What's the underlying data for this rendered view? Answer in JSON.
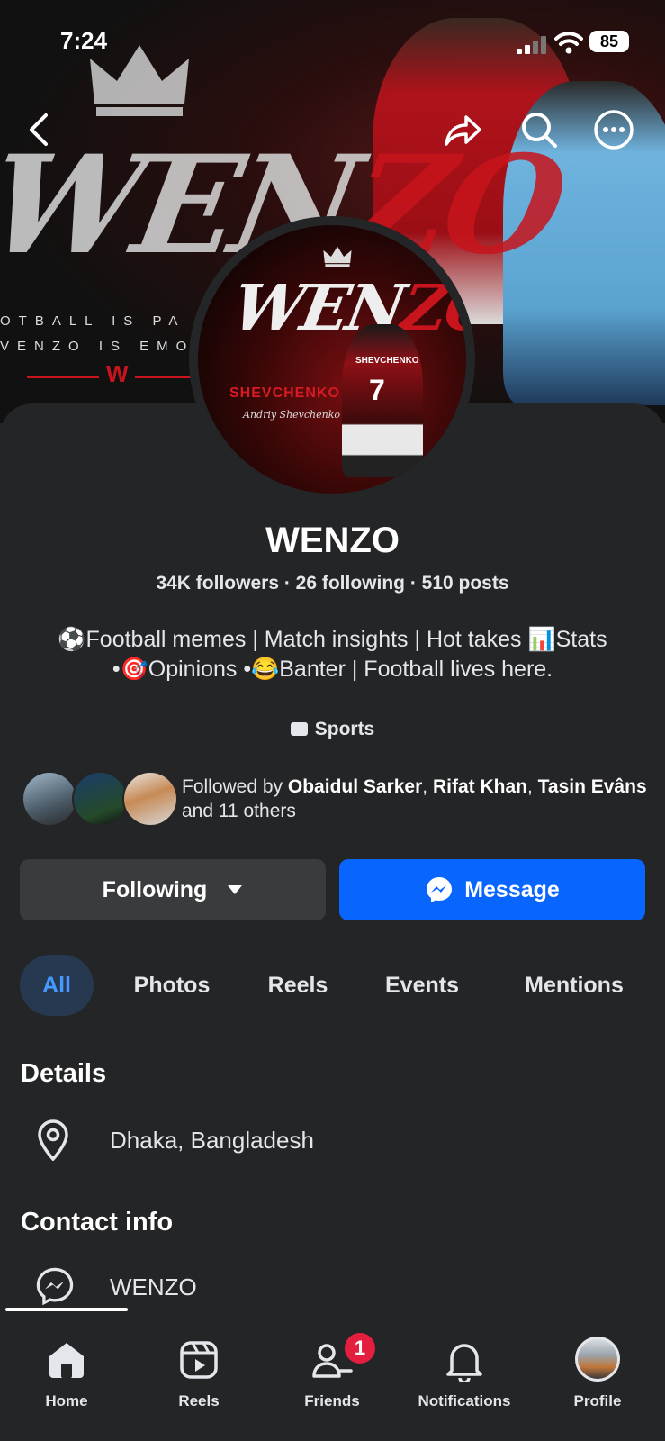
{
  "status_bar": {
    "time": "7:24",
    "battery": "85"
  },
  "cover": {
    "brush_text_white": "WEN",
    "brush_text_red": "ZO",
    "tagline_1": "OTBALL IS PA",
    "tagline_2": "VENZO IS EMO",
    "logo_letter": "W"
  },
  "avatar": {
    "title_white": "WEN",
    "title_red": "ZO",
    "caption": "SHEVCHENKO",
    "signature": "Andriy Shevchenko",
    "shirt_name": "SHEVCHENKO",
    "shirt_number": "7"
  },
  "profile": {
    "name": "WENZO",
    "stats": "34K followers · 26 following · 510 posts",
    "bio_line1": "⚽Football memes | Match insights | Hot takes 📊Stats",
    "bio_line2": "•🎯Opinions •😂Banter | Football lives here.",
    "category": "Sports",
    "mutual_prefix": "Followed by ",
    "mutual_name1": "Obaidul Sarker",
    "mutual_sep": ", ",
    "mutual_name2": "Rifat Khan",
    "mutual_name3": "Tasin Evâns",
    "mutual_suffix": " and 11 others"
  },
  "actions": {
    "following_label": "Following",
    "message_label": "Message"
  },
  "tabs": [
    "All",
    "Photos",
    "Reels",
    "Events",
    "Mentions"
  ],
  "details": {
    "heading": "Details",
    "location": "Dhaka, Bangladesh"
  },
  "contact": {
    "heading": "Contact info",
    "messenger": "WENZO"
  },
  "nav": {
    "home": "Home",
    "reels": "Reels",
    "friends": "Friends",
    "friends_badge": "1",
    "notifications": "Notifications",
    "profile": "Profile"
  },
  "colors": {
    "accent": "#0866ff",
    "background": "#242526",
    "brand_red": "#c8141c"
  }
}
